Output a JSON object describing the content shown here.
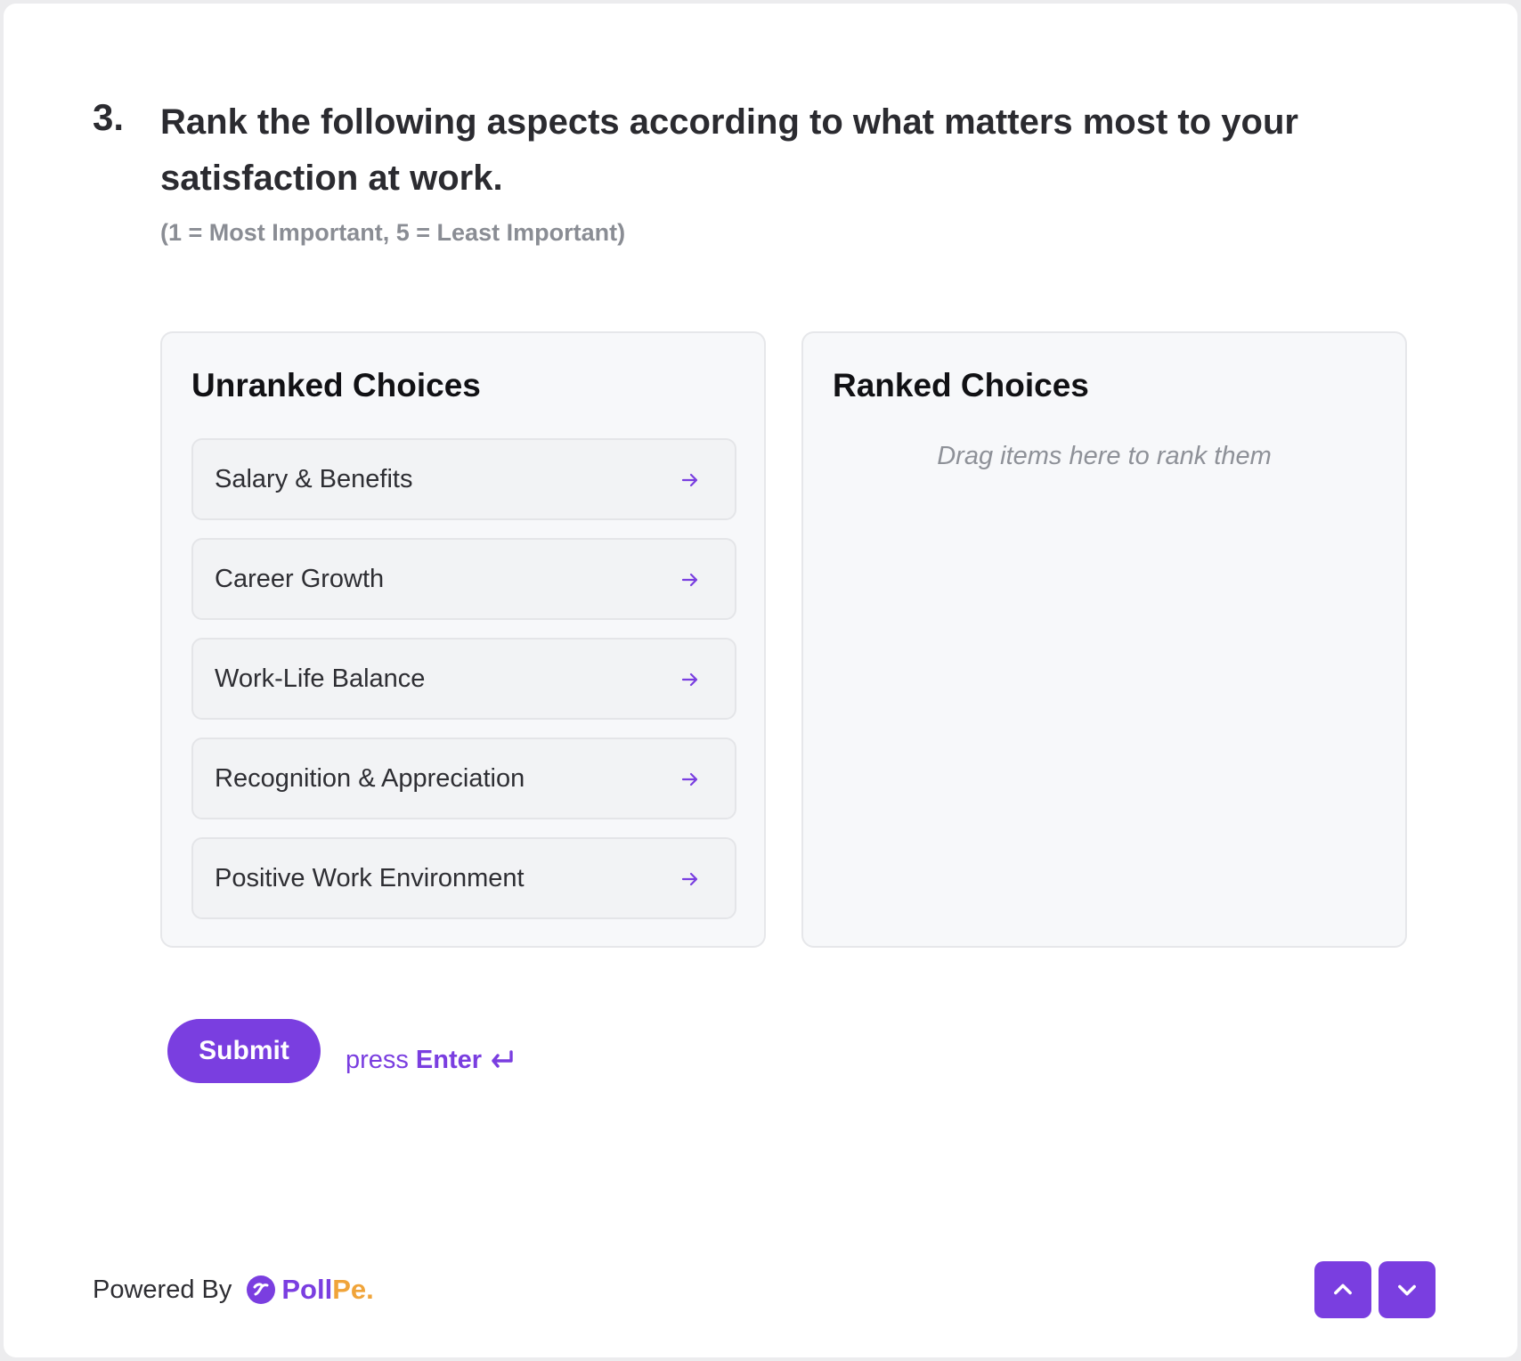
{
  "question": {
    "number": "3.",
    "text": "Rank the following aspects according to what matters most to your satisfaction at work.",
    "hint": "(1 = Most Important, 5 = Least Important)"
  },
  "unranked": {
    "title": "Unranked Choices",
    "items": [
      {
        "label": "Salary & Benefits",
        "icon": "arrow-right-icon"
      },
      {
        "label": "Career Growth",
        "icon": "arrow-right-icon"
      },
      {
        "label": "Work-Life Balance",
        "icon": "arrow-right-icon"
      },
      {
        "label": "Recognition & Appreciation",
        "icon": "arrow-right-icon"
      },
      {
        "label": "Positive Work Environment",
        "icon": "arrow-right-icon"
      }
    ]
  },
  "ranked": {
    "title": "Ranked Choices",
    "placeholder": "Drag items here to rank them"
  },
  "actions": {
    "submit_label": "Submit",
    "press_label": "press",
    "enter_label": "Enter",
    "enter_icon": "enter-return-icon"
  },
  "footer": {
    "powered_by": "Powered By",
    "brand_part1": "Poll",
    "brand_part2": "Pe.",
    "nav_up_icon": "chevron-up-icon",
    "nav_down_icon": "chevron-down-icon"
  },
  "colors": {
    "accent": "#7a3ee0",
    "brand_secondary": "#f0a43a",
    "panel_bg": "#f7f8fa",
    "choice_bg": "#f2f3f5",
    "hint_gray": "#8a8d94"
  }
}
